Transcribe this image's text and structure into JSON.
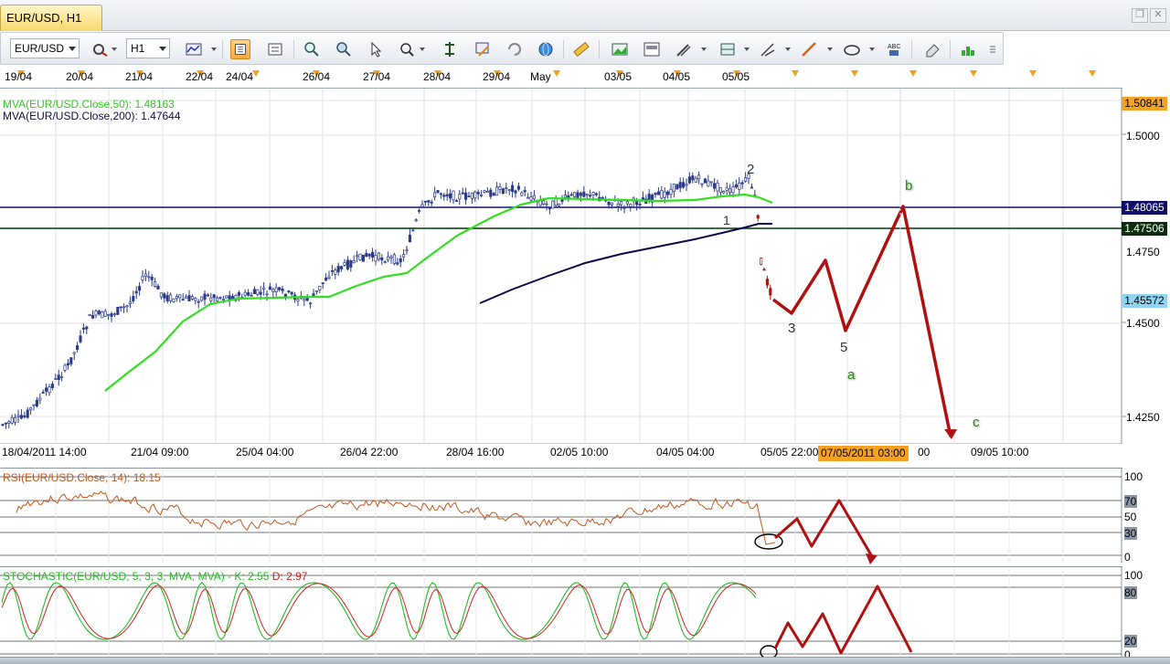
{
  "tab": {
    "title": "EUR/USD, H1"
  },
  "toolbar": {
    "symbol": "EUR/USD",
    "timeframe": "H1",
    "icons": [
      "chart-type-icon",
      "properties-icon",
      "candles-icon",
      "bars-icon",
      "zoom-in-icon",
      "zoom-out-icon",
      "cursor-icon",
      "magnifier-icon",
      "crosshair-icon",
      "annotation-icon",
      "refresh-icon",
      "globe-icon",
      "ruler-icon",
      "image-icon",
      "template-icon",
      "tools-icon",
      "indicator-icon",
      "pen-icon",
      "line-icon",
      "ellipse-icon",
      "text-icon",
      "eraser-icon",
      "layout-icon"
    ]
  },
  "date_bar": [
    "19/04",
    "20/04",
    "21/04",
    "22/04",
    "24/04",
    "26/04",
    "27/04",
    "28/04",
    "29/04",
    "May",
    "03/05",
    "04/05",
    "05/05"
  ],
  "indicators": {
    "ma50": "MVA(EUR/USD.Close,50): 1.48163",
    "ma200": "MVA(EUR/USD.Close,200): 1.47644"
  },
  "price_tags": {
    "top": "1.50841",
    "blue_line": "1.48065",
    "green_line": "1.47506",
    "current": "1.45572"
  },
  "price_axis": [
    "1.5000",
    "1.4750",
    "1.4500",
    "1.4250"
  ],
  "time_axis": [
    "18/04/2011 14:00",
    "21/04 09:00",
    "25/04 04:00",
    "26/04 22:00",
    "28/04 16:00",
    "02/05 10:00",
    "04/05 04:00",
    "05/05 22:00",
    "00",
    "09/05 10:00"
  ],
  "time_highlight": "07/05/2011 03:00",
  "wave_labels": {
    "w1": "1",
    "w2": "2",
    "w3": "3",
    "w5": "5",
    "wa": "a",
    "wb": "b",
    "wc": "c"
  },
  "rsi": {
    "label": "RSI(EUR/USD.Close, 14): 18.15",
    "levels": [
      "100",
      "70",
      "50",
      "30",
      "0"
    ]
  },
  "stochastic": {
    "label_main": "STOCHASTIC(EUR/USD, 5, 3, 3, MVA, MVA) -  K: 2.55",
    "label_d": "D: 2.97",
    "levels": [
      "100",
      "80",
      "20",
      "0"
    ]
  },
  "colors": {
    "ma50": "#33dd22",
    "ma200": "#0b0b4a",
    "blue_line": "#13137a",
    "green_line": "#0c3a0c",
    "projection": "#b01010",
    "rsi": "#c0581e",
    "stoch_k": "#22bb22",
    "stoch_d": "#cc2222"
  }
}
